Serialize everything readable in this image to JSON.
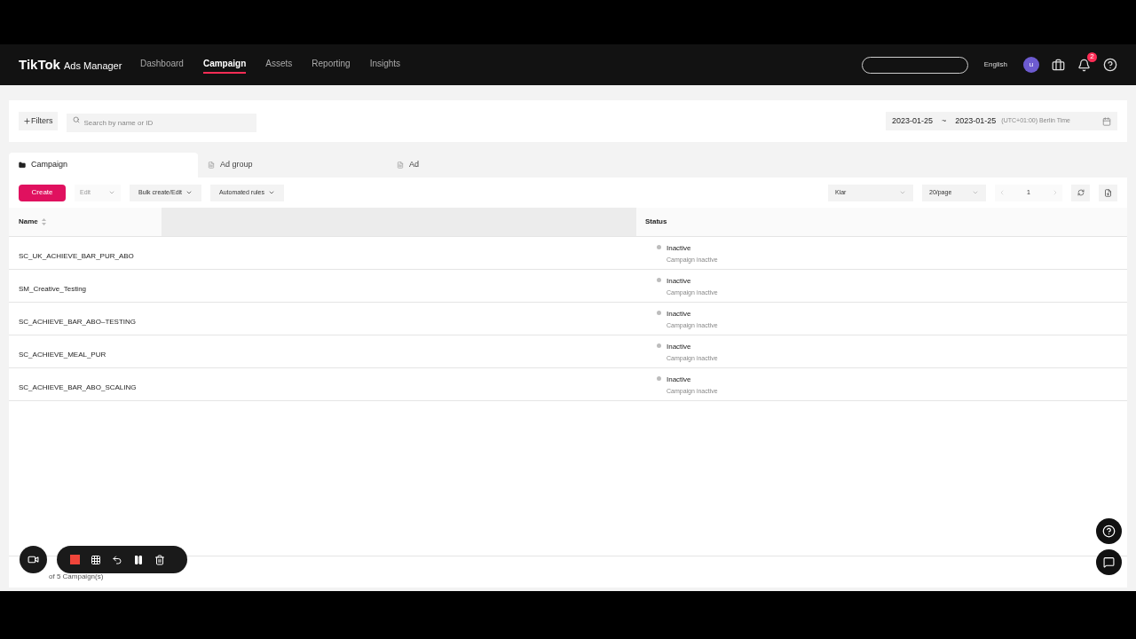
{
  "header": {
    "logo": "TikTok",
    "logo_suffix": "Ads Manager",
    "nav": [
      {
        "label": "Dashboard",
        "selected": false
      },
      {
        "label": "Campaign",
        "selected": true
      },
      {
        "label": "Assets",
        "selected": false
      },
      {
        "label": "Reporting",
        "selected": false
      },
      {
        "label": "Insights",
        "selected": false
      }
    ],
    "language": "English",
    "avatar": "u",
    "notifications": "2"
  },
  "filters": {
    "button": "Filters",
    "search": {
      "placeholder": "Search by name or ID"
    },
    "date_start": "2023-01-25",
    "date_sep": "~",
    "date_end": "2023-01-25",
    "timezone": "(UTC+01:00) Berlin Time"
  },
  "tabs": [
    {
      "label": "Campaign",
      "selected": true
    },
    {
      "label": "Ad group",
      "selected": false
    },
    {
      "label": "Ad",
      "selected": false
    }
  ],
  "toolbar": {
    "create": "Create",
    "edit": {
      "label": "Edit",
      "disabled": true
    },
    "bulk": "Bulk create/Edit",
    "rules": "Automated rules",
    "view": "Klar",
    "page_size": "20/page",
    "page": "1"
  },
  "table": {
    "columns": [
      "Name",
      "Status"
    ],
    "rows": [
      {
        "name": "SC_UK_ACHIEVE_BAR_PUR_ABO",
        "status": "Inactive",
        "detail": "Campaign inactive",
        "color": "#bdbdbd"
      },
      {
        "name": "SM_Creative_Testing",
        "status": "Inactive",
        "detail": "Campaign inactive",
        "color": "#bdbdbd"
      },
      {
        "name": "SC_ACHIEVE_BAR_ABO–TESTING",
        "status": "Inactive",
        "detail": "Campaign inactive",
        "color": "#bdbdbd"
      },
      {
        "name": "SC_ACHIEVE_MEAL_PUR",
        "status": "Inactive",
        "detail": "Campaign inactive",
        "color": "#bdbdbd"
      },
      {
        "name": "SC_ACHIEVE_BAR_ABO_SCALING",
        "status": "Inactive",
        "detail": "Campaign inactive",
        "color": "#bdbdbd"
      }
    ]
  },
  "footer": "of 5 Campaign(s)"
}
